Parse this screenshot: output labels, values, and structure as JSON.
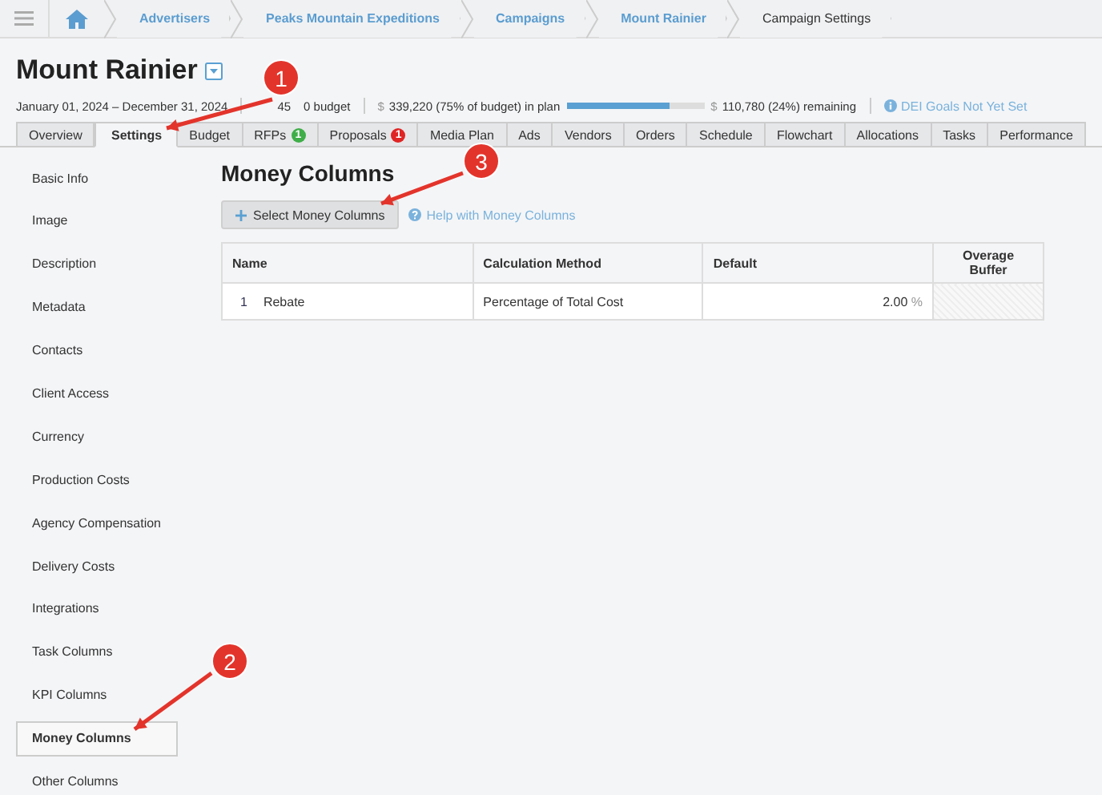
{
  "breadcrumbs": [
    {
      "label": "Advertisers",
      "kind": "link"
    },
    {
      "label": "Peaks Mountain Expeditions",
      "kind": "link"
    },
    {
      "label": "Campaigns",
      "kind": "link"
    },
    {
      "label": "Mount Rainier",
      "kind": "link"
    },
    {
      "label": "Campaign Settings",
      "kind": "current"
    }
  ],
  "title": "Mount Rainier",
  "meta": {
    "dates": "January 01, 2024 – December 31, 2024",
    "budget_start": "45",
    "budget_end": "0 budget",
    "plan_currency": "$",
    "plan": "339,220 (75% of budget) in plan",
    "plan_progress": {
      "level": 0.75
    },
    "remaining_currency": "$",
    "remaining": "110,780 (24%) remaining",
    "dei": "DEI Goals Not Yet Set"
  },
  "tabs": [
    {
      "label": "Overview",
      "selected": false
    },
    {
      "label": "Settings",
      "selected": true
    },
    {
      "label": "Budget",
      "selected": false
    },
    {
      "label": "RFPs",
      "selected": false,
      "badge": "1",
      "color": "#3fae49"
    },
    {
      "label": "Proposals",
      "selected": false,
      "badge": "1",
      "color": "#e02424"
    },
    {
      "label": "Media Plan",
      "selected": false
    },
    {
      "label": "Ads",
      "selected": false
    },
    {
      "label": "Vendors",
      "selected": false
    },
    {
      "label": "Orders",
      "selected": false
    },
    {
      "label": "Schedule",
      "selected": false
    },
    {
      "label": "Flowchart",
      "selected": false
    },
    {
      "label": "Allocations",
      "selected": false
    },
    {
      "label": "Tasks",
      "selected": false
    },
    {
      "label": "Performance",
      "selected": false
    }
  ],
  "sidebar": {
    "items": [
      {
        "label": "Basic Info",
        "selected": false
      },
      {
        "label": "Image",
        "selected": false
      },
      {
        "label": "Description",
        "selected": false
      },
      {
        "label": "Metadata",
        "selected": false
      },
      {
        "label": "Contacts",
        "selected": false
      },
      {
        "label": "Client Access",
        "selected": false
      },
      {
        "label": "Currency",
        "selected": false
      },
      {
        "label": "Production Costs",
        "selected": false
      },
      {
        "label": "Agency Compensation",
        "selected": false
      },
      {
        "label": "Delivery Costs",
        "selected": false
      },
      {
        "label": "Integrations",
        "selected": false
      },
      {
        "label": "Task Columns",
        "selected": false
      },
      {
        "label": "KPI Columns",
        "selected": false
      },
      {
        "label": "Money Columns",
        "selected": true
      },
      {
        "label": "Other Columns",
        "selected": false
      }
    ]
  },
  "content": {
    "heading": "Money Columns",
    "select_button": "Select Money Columns",
    "help_link": "Help with Money Columns",
    "table": {
      "columns": [
        "Name",
        "Calculation Method",
        "Default",
        "Overage Buffer"
      ],
      "rows": [
        {
          "index": "1",
          "name": "Rebate",
          "method": "Percentage of Total Cost",
          "default": "2.00",
          "unit": "%"
        }
      ]
    }
  },
  "annotations": [
    {
      "number": "1"
    },
    {
      "number": "2"
    },
    {
      "number": "3"
    }
  ]
}
